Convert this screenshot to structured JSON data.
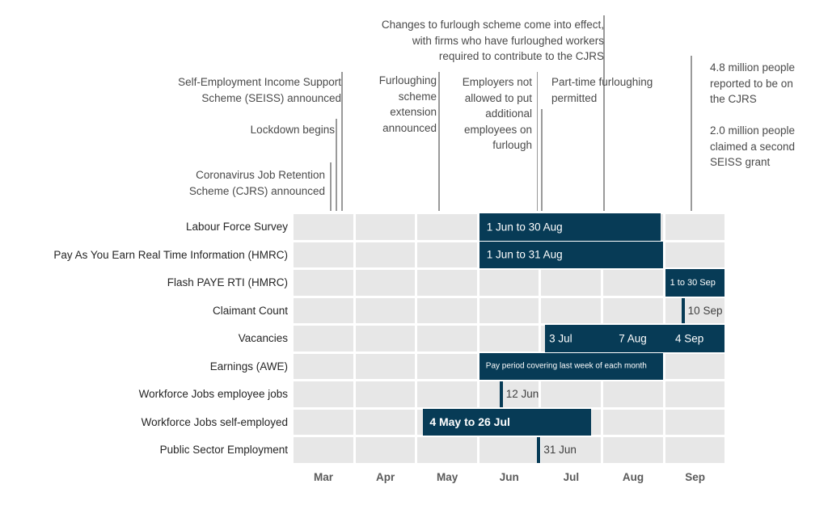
{
  "chart_data": {
    "type": "gantt-timeline",
    "title": "",
    "x_axis": {
      "months": [
        "Mar",
        "Apr",
        "May",
        "Jun",
        "Jul",
        "Aug",
        "Sep"
      ],
      "range": [
        "1 Mar",
        "30 Sep"
      ]
    },
    "rows": [
      {
        "label": "Labour Force Survey",
        "spans": [
          {
            "start": [
              3,
              1
            ],
            "end": [
              5,
              30
            ],
            "text": "1 Jun to 30 Aug",
            "text_size": "normal"
          }
        ]
      },
      {
        "label": "Pay As You Earn Real Time Information (HMRC)",
        "spans": [
          {
            "start": [
              3,
              1
            ],
            "end": [
              5,
              31
            ],
            "text": "1 Jun to 31 Aug",
            "text_size": "normal"
          }
        ]
      },
      {
        "label": "Flash PAYE RTI (HMRC)",
        "spans": [
          {
            "start": [
              6,
              1
            ],
            "end": [
              6,
              30
            ],
            "text": "1 to 30 Sep",
            "text_size": "small"
          }
        ]
      },
      {
        "label": "Claimant Count",
        "points": [
          {
            "date": [
              6,
              10
            ],
            "text": "10 Sep"
          }
        ]
      },
      {
        "label": "Vacancies",
        "spans": [
          {
            "start": [
              4,
              3
            ],
            "end": [
              6,
              30
            ],
            "labels": [
              "3 Jul",
              "7 Aug",
              "4 Sep"
            ],
            "label_dates": [
              [
                4,
                3
              ],
              [
                5,
                7
              ],
              [
                6,
                4
              ]
            ]
          }
        ]
      },
      {
        "label": "Earnings (AWE)",
        "spans": [
          {
            "start": [
              3,
              1
            ],
            "end": [
              5,
              31
            ],
            "text": "Pay period covering last week of each month",
            "text_size": "tiny"
          }
        ]
      },
      {
        "label": "Workforce Jobs employee jobs",
        "points": [
          {
            "date": [
              3,
              12
            ],
            "text": "12 Jun"
          }
        ]
      },
      {
        "label": "Workforce Jobs self-employed",
        "spans": [
          {
            "start": [
              2,
              4
            ],
            "end": [
              4,
              26
            ],
            "text": "4 May to 26 Jul",
            "text_size": "bold"
          }
        ]
      },
      {
        "label": "Public Sector Employment",
        "points": [
          {
            "date": [
              3,
              31
            ],
            "text": "31 Jun"
          }
        ]
      }
    ],
    "annotations": [
      {
        "text": "Coronavirus Job Retention\nScheme (CJRS) announced",
        "date": [
          0,
          20
        ],
        "align": "right"
      },
      {
        "text": "Lockdown begins",
        "date": [
          0,
          23
        ],
        "align": "right"
      },
      {
        "text": "Self-Employment Income Support\nScheme (SEISS) announced",
        "date": [
          0,
          26
        ],
        "align": "right"
      },
      {
        "text": "Furloughing\nscheme\nextension\nannounced",
        "date": [
          2,
          12
        ],
        "align": "right"
      },
      {
        "text": "Employers not\nallowed to put\nadditional\nemployees on\nfurlough",
        "date": [
          3,
          30
        ],
        "align": "right"
      },
      {
        "text": "Changes to furlough scheme come into effect,\nwith firms who have furloughed workers\nrequired to contribute to the CJRS",
        "date": [
          5,
          1
        ],
        "align": "right"
      },
      {
        "text": "Part-time furloughing\npermitted",
        "date": [
          4,
          1
        ],
        "align": "left"
      },
      {
        "text": "4.8 million people\nreported to be on\nthe CJRS\n\n2.0 million people\nclaimed a second\nSEISS grant",
        "date": [
          6,
          14
        ],
        "align": "left"
      }
    ],
    "colors": {
      "bar": "#073b56",
      "cell": "#e7e7e7",
      "line": "#9a9a9a"
    },
    "grid": true,
    "legend": "none"
  }
}
